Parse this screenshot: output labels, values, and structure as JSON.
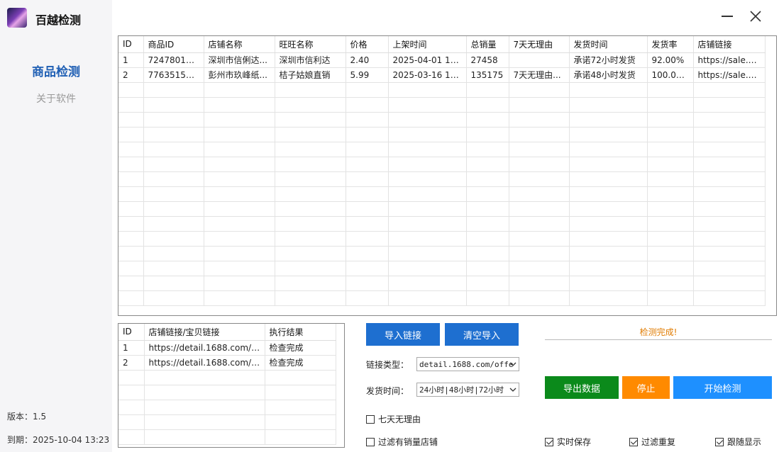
{
  "app": {
    "title": "百越检测"
  },
  "nav": {
    "items": [
      {
        "label": "商品检测"
      },
      {
        "label": "关于软件"
      }
    ]
  },
  "sidebar": {
    "version": "版本：1.5",
    "expiry": "到期：2025-10-04 13:23"
  },
  "results_table": {
    "columns": [
      "ID",
      "商品ID",
      "店铺名称",
      "旺旺名称",
      "价格",
      "上架时间",
      "总销量",
      "7天无理由",
      "发货时间",
      "发货率",
      "店铺链接"
    ],
    "rows": [
      [
        "1",
        "724780130...",
        "深圳市信俐达...",
        "深圳市信利达",
        "2.40",
        "2025-04-01 19:...",
        "27458",
        "",
        "承诺72小时发货",
        "92.00%",
        "https://sale.1..."
      ],
      [
        "2",
        "776351599...",
        "彭州市玖峰纸...",
        "桔子姑娘直销",
        "5.99",
        "2025-03-16 10:...",
        "135175",
        "7天无理由...",
        "承诺48小时发货",
        "100.00%",
        "https://sale.1..."
      ]
    ]
  },
  "links_table": {
    "columns": [
      "ID",
      "店铺链接/宝贝链接",
      "执行结果"
    ],
    "rows": [
      [
        "1",
        "https://detail.1688.com/o...",
        "检查完成"
      ],
      [
        "2",
        "https://detail.1688.com/o...",
        "检查完成"
      ]
    ]
  },
  "controls": {
    "import_button": "导入链接",
    "clear_button": "清空导入",
    "link_type_label": "链接类型：",
    "link_type_value": "detail.1688.com/offe",
    "ship_time_label": "发货时间：",
    "ship_time_value": "24小时|48小时|72小时",
    "seven_day_checkbox": "七天无理由",
    "filter_sales_checkbox": "过滤有销量店铺",
    "status_text": "检测完成!",
    "export_button": "导出数据",
    "stop_button": "停止",
    "start_button": "开始检测",
    "realtime_save": "实时保存",
    "filter_duplicate": "过滤重复",
    "follow_display": "跟随显示"
  },
  "colors": {
    "accent": "#1f5fb4",
    "button_blue": "#1e6fd0",
    "export_green": "#0b8a1b",
    "stop_orange": "#ff8a00",
    "start_blue": "#1e90ff",
    "status_orange": "#e07b00"
  },
  "icons": {
    "minimize": "minimize-icon",
    "close": "close-icon",
    "logo": "app-logo-icon",
    "dropdown": "chevron-down-icon"
  }
}
